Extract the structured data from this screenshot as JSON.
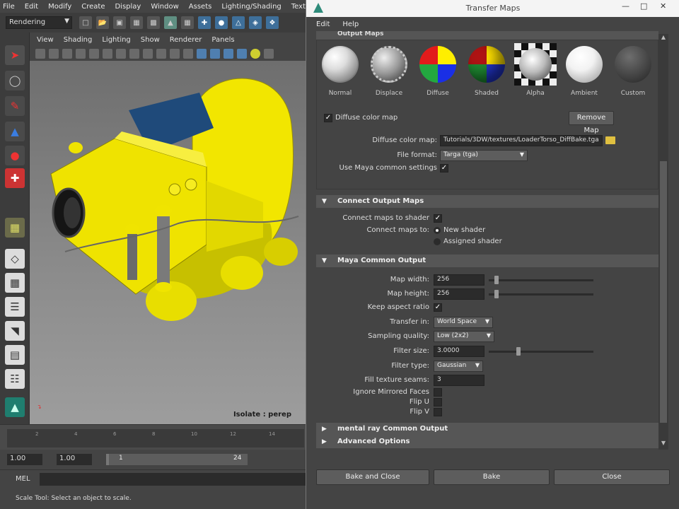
{
  "maya": {
    "main_menu": [
      "File",
      "Edit",
      "Modify",
      "Create",
      "Display",
      "Window",
      "Assets",
      "Lighting/Shading",
      "Texturing"
    ],
    "mode_menu": "Rendering",
    "panel_menu": [
      "View",
      "Shading",
      "Lighting",
      "Show",
      "Renderer",
      "Panels"
    ],
    "isolate_label": "Isolate : perep",
    "timeline_ticks": [
      "2",
      "4",
      "6",
      "8",
      "10",
      "12",
      "14"
    ],
    "range": {
      "start": "1.00",
      "playback_start": "1.00",
      "slider_min": "1",
      "slider_max": "24"
    },
    "command_label": "MEL",
    "help_line": "Scale Tool: Select an object to scale."
  },
  "dialog": {
    "title": "Transfer Maps",
    "menu": [
      "Edit",
      "Help"
    ],
    "output_maps_header": "Output Maps",
    "map_types": [
      {
        "label": "Normal"
      },
      {
        "label": "Displace"
      },
      {
        "label": "Diffuse"
      },
      {
        "label": "Shaded"
      },
      {
        "label": "Alpha"
      },
      {
        "label": "Ambient"
      },
      {
        "label": "Custom"
      }
    ],
    "diffuse_toggle": "Diffuse color map",
    "remove_map": "Remove Map",
    "diffuse_path_label": "Diffuse color map:",
    "diffuse_path": "Tutorials/3DW/textures/LoaderTorso_DiffBake.tga",
    "file_format_label": "File format:",
    "file_format": "Targa (tga)",
    "use_common_label": "Use Maya common settings",
    "connect_header": "Connect Output Maps",
    "connect_to_shader_label": "Connect maps to shader",
    "connect_to_label": "Connect maps to:",
    "new_shader": "New shader",
    "assigned_shader": "Assigned shader",
    "common_header": "Maya Common Output",
    "map_width_label": "Map width:",
    "map_width": "256",
    "map_height_label": "Map height:",
    "map_height": "256",
    "keep_aspect_label": "Keep aspect ratio",
    "transfer_in_label": "Transfer in:",
    "transfer_in": "World Space",
    "sampling_label": "Sampling quality:",
    "sampling": "Low (2x2)",
    "filter_size_label": "Filter size:",
    "filter_size": "3.0000",
    "filter_type_label": "Filter type:",
    "filter_type": "Gaussian",
    "fill_seams_label": "Fill texture seams:",
    "fill_seams": "3",
    "ignore_mirrored_label": "Ignore Mirrored Faces",
    "flip_u_label": "Flip U",
    "flip_v_label": "Flip V",
    "mental_ray_header": "mental ray Common Output",
    "advanced_header": "Advanced Options",
    "footer": {
      "bake_close": "Bake and Close",
      "bake": "Bake",
      "close": "Close"
    }
  }
}
